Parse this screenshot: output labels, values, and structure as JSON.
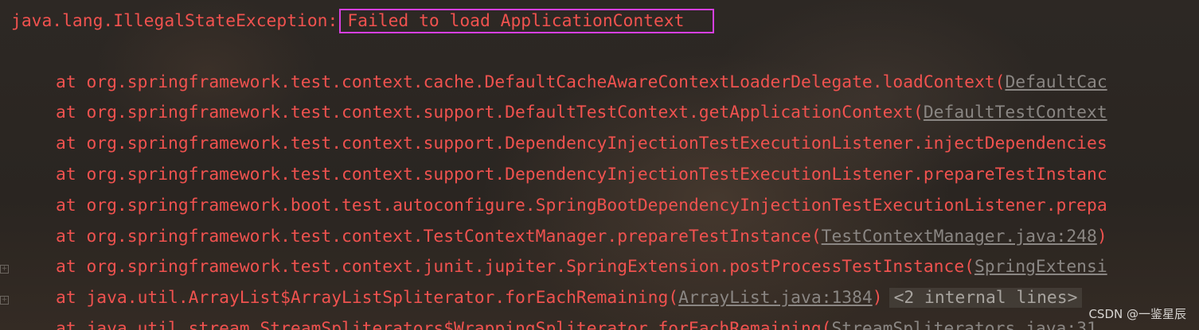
{
  "exception": {
    "type": "java.lang.IllegalStateException:",
    "message": "Failed to load ApplicationContext"
  },
  "frames": [
    {
      "prefix": "at ",
      "method": "org.springframework.test.context.cache.DefaultCacheAwareContextLoaderDelegate.loadContext(",
      "link": "DefaultCac",
      "suffix": ""
    },
    {
      "prefix": "at ",
      "method": "org.springframework.test.context.support.DefaultTestContext.getApplicationContext(",
      "link": "DefaultTestContext",
      "suffix": ""
    },
    {
      "prefix": "at ",
      "method": "org.springframework.test.context.support.DependencyInjectionTestExecutionListener.injectDependencies",
      "link": "",
      "suffix": ""
    },
    {
      "prefix": "at ",
      "method": "org.springframework.test.context.support.DependencyInjectionTestExecutionListener.prepareTestInstanc",
      "link": "",
      "suffix": ""
    },
    {
      "prefix": "at ",
      "method": "org.springframework.boot.test.autoconfigure.SpringBootDependencyInjectionTestExecutionListener.prepa",
      "link": "",
      "suffix": ""
    },
    {
      "prefix": "at ",
      "method": "org.springframework.test.context.TestContextManager.prepareTestInstance(",
      "link": "TestContextManager.java:248",
      "suffix": ")"
    },
    {
      "prefix": "at ",
      "method": "org.springframework.test.context.junit.jupiter.SpringExtension.postProcessTestInstance(",
      "link": "SpringExtensi",
      "suffix": ""
    },
    {
      "prefix": "at ",
      "method": "java.util.ArrayList$ArrayListSpliterator.forEachRemaining(",
      "link": "ArrayList.java:1384",
      "suffix": ")",
      "collapsed": "<2 internal lines>"
    },
    {
      "prefix": "at ",
      "method": "java.util.stream.StreamSpliterators$WrappingSpliterator.forEachRemaining(",
      "link": "StreamSpliterators.java:31",
      "suffix": ""
    }
  ],
  "gutter": {
    "expand_symbol": "+"
  },
  "watermark": "CSDN @一鉴星辰",
  "colors": {
    "error_text": "#f0524f",
    "link_text": "#8a8683",
    "highlight_box": "#d63fe0",
    "background": "#2b2622"
  }
}
